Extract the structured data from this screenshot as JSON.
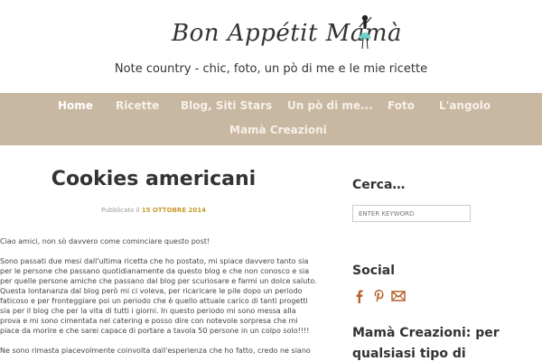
{
  "site": {
    "logo_text": "Bon Appétit Mamà",
    "tagline": "Note country - chic, foto, un pò di me e le mie ricette"
  },
  "nav": {
    "items": [
      {
        "label": "Home"
      },
      {
        "label": "Ricette"
      },
      {
        "label": "Blog, Siti Stars"
      },
      {
        "label": "Un pò di me..."
      },
      {
        "label": "Foto"
      },
      {
        "label": "L'angolo"
      },
      {
        "label": "Mamà Creazioni"
      }
    ]
  },
  "post": {
    "title": "Cookies americani",
    "meta_prefix": "Pubblicato il",
    "date": "15 OTTOBRE 2014",
    "paragraphs": [
      "Ciao amici, non sò davvero come cominciare questo post!",
      "Sono passati due mesi dall'ultima ricetta che ho postato, mi spiace davvero tanto sia per le persone che passano quotidianamente da questo blog e che non conosco e sia per quelle persone amiche che passano dal blog per scuriosare e farmi un dolce saluto. Questa lontananza dal blog però mi ci voleva, per ricaricare le pile dopo un periodo faticoso e per fronteggiare poi un periodo che è quello attuale carico di tanti progetti sia per il blog che per la vita di tutti i giorni. In questo periodo mi sono messa alla prova e mi sono cimentata nel catering e posso dire con notevole sorpresa che mi piace da morire e che sarei capace di portare a tavola 50 persone in un colpo solo!!!!",
      "Ne sono rimasta piacevolmente coinvolta dall'esperienza che ho fatto, credo ne siano"
    ]
  },
  "sidebar": {
    "search_heading": "Cerca…",
    "search_placeholder": "ENTER KEYWORD",
    "social_heading": "Social",
    "social_icons": [
      "facebook-icon",
      "pinterest-icon",
      "mail-icon"
    ],
    "mama_heading": "Mamà Creazioni: per qualsiasi tipo di"
  },
  "colors": {
    "nav_bg": "#c8b7a1",
    "date_accent": "#c89b2e"
  }
}
